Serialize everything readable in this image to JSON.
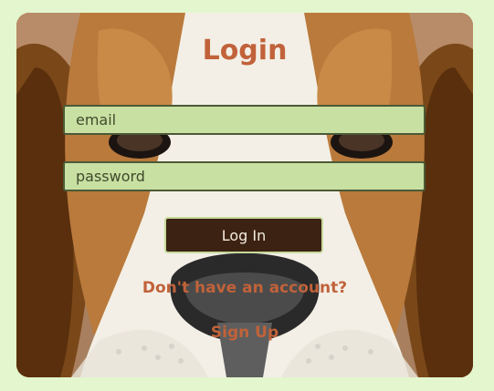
{
  "login": {
    "title": "Login",
    "email_placeholder": "email",
    "password_placeholder": "password",
    "button_label": "Log In",
    "prompt_text": "Don't have an account?",
    "signup_link": "Sign Up"
  },
  "colors": {
    "page_background": "#e4f6cd",
    "accent": "#c1623a",
    "field_fill": "#c9e0a3",
    "field_border": "#4b5a36",
    "button_fill": "#3c2212",
    "button_text": "#f3ecde"
  }
}
